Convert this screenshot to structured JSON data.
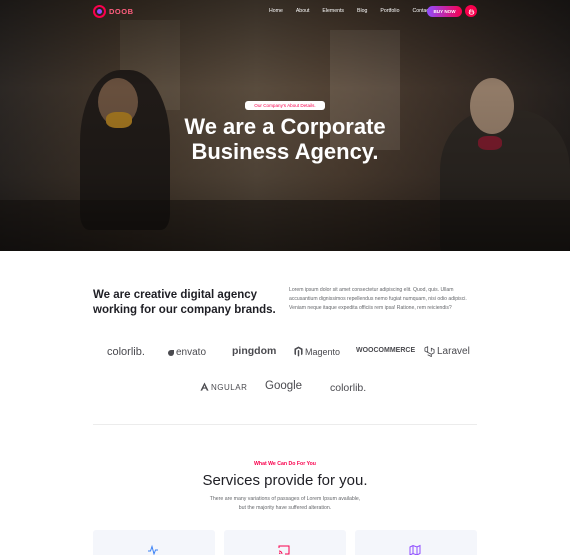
{
  "header": {
    "logo_text": "DOOB",
    "menu": [
      "Home",
      "About",
      "Elements",
      "Blog",
      "Portfolio",
      "Contact"
    ],
    "buy_button": "BUY NOW",
    "accent_gradient": [
      "#8f4dff",
      "#f9004d"
    ]
  },
  "hero": {
    "badge": "Our Company's About Details.",
    "title_line1": "We are a Corporate",
    "title_line2": "Business Agency."
  },
  "about": {
    "title": "We are creative digital agency working for our company brands.",
    "text": "Lorem ipsum dolor sit amet consectetur adipiscing elit. Quod, quis. Ullam accusantium dignissimos repellendus nemo fugiat numquam, nisi odio adipisci. Veniam neque itaque expedita officiis rem ipsa! Ratione, rem reiciendis?"
  },
  "brands": {
    "row1": [
      "colorlib.",
      "envato",
      "pingdom",
      "Magento",
      "WOOCOMMERCE",
      "Laravel"
    ],
    "row2": [
      "NGULAR",
      "Google",
      "colorlib."
    ]
  },
  "services": {
    "subtitle": "What We Can Do For You",
    "title": "Services provide for you.",
    "description_line1": "There are many variations of passages of Lorem Ipsum available,",
    "description_line2": "but the majority have suffered alteration."
  }
}
